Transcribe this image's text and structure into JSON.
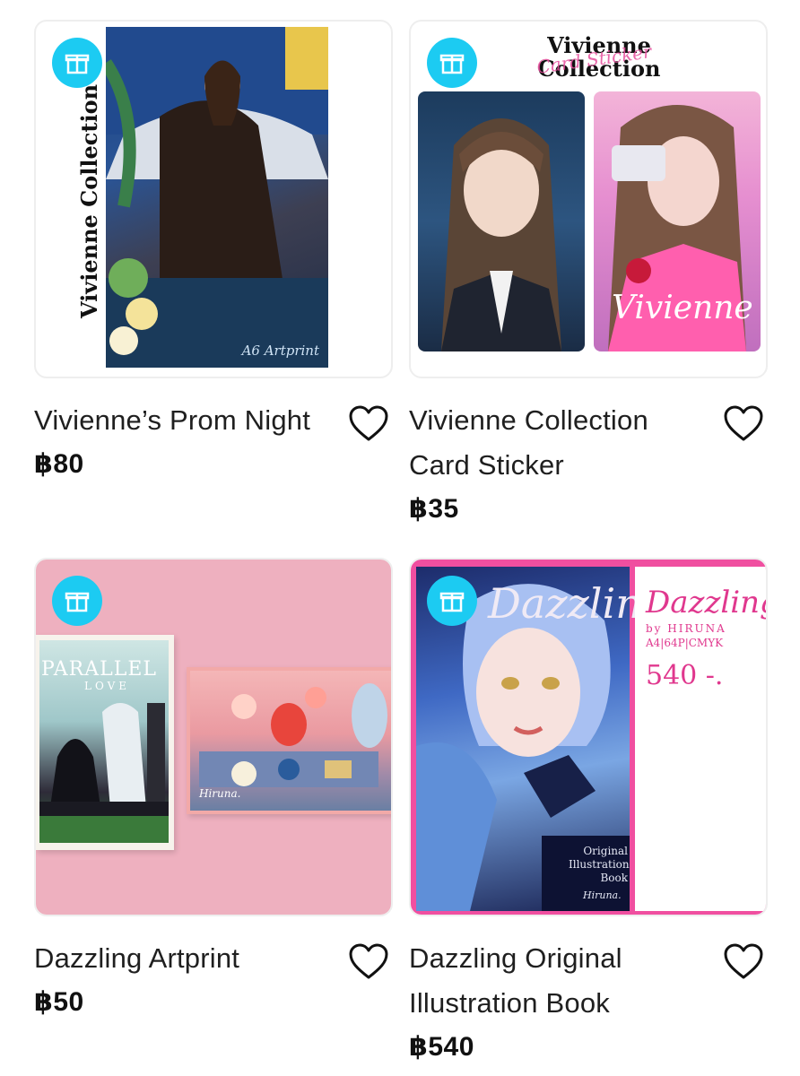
{
  "products": [
    {
      "title": "Vivienne’s Prom Night",
      "price": "฿80",
      "image": {
        "vertical_title": "Vivienne Collection",
        "script_text": "A6 Artprint"
      }
    },
    {
      "title": "Vivienne Collection Card Sticker",
      "price": "฿35",
      "image": {
        "header": "Vivienne Collection",
        "script_text": "Card Sticker",
        "card_script": "Vivienne"
      }
    },
    {
      "title": "Dazzling Artprint",
      "price": "฿50",
      "image": {
        "print_title": "PARALLEL",
        "print_subtitle": "LOVE",
        "signature": "Hiruna."
      }
    },
    {
      "title": "Dazzling Original Illustration Book",
      "price": "฿540",
      "image": {
        "cover_title": "Dazzling",
        "back_title": "Dazzling",
        "back_byline": "by HIRUNA",
        "back_specs": "A4|64P|CMYK",
        "back_price": "540 -.",
        "cover_footer": "Original Illustration Book",
        "signature": "Hiruna."
      }
    }
  ],
  "icons": {
    "badge": "gift-icon",
    "favorite": "heart-outline-icon"
  },
  "colors": {
    "badge": "#1ccbf2",
    "text": "#1f1f1f",
    "price": "#111111"
  }
}
